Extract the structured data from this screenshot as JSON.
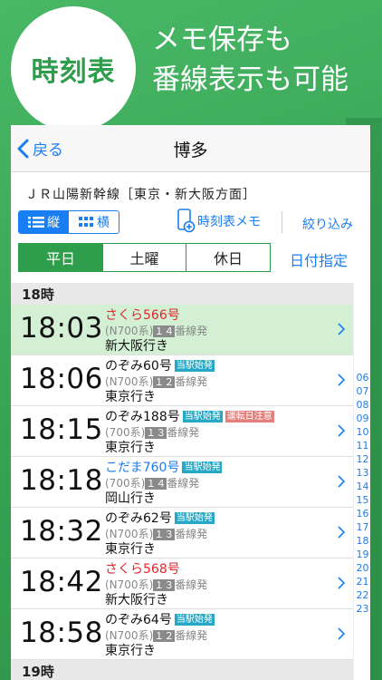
{
  "promo": {
    "circle_text": "時刻表",
    "line1": "メモ保存も",
    "line2": "番線表示も可能"
  },
  "nav": {
    "back_label": "戻る",
    "title": "博多"
  },
  "line_name": "ＪＲ山陽新幹線［東京・新大阪方面］",
  "toolbar": {
    "vertical_label": "縦",
    "horizontal_label": "横",
    "memo_label": "時刻表メモ",
    "filter_label": "絞り込み"
  },
  "day_tabs": {
    "weekday": "平日",
    "saturday": "土曜",
    "holiday": "休日",
    "date_pick": "日付指定"
  },
  "hour18": "18時",
  "hour19": "19時",
  "rows": [
    {
      "time": "18:03",
      "name": "さくら566号",
      "badge1": "",
      "badge2": "",
      "series": "(N700系)",
      "track": "１４",
      "track_suffix": "番線発",
      "dest": "新大阪行き"
    },
    {
      "time": "18:06",
      "name": "のぞみ60号",
      "badge1": "当駅始発",
      "badge2": "",
      "series": "(N700系)",
      "track": "１２",
      "track_suffix": "番線発",
      "dest": "東京行き"
    },
    {
      "time": "18:15",
      "name": "のぞみ188号",
      "badge1": "当駅始発",
      "badge2": "運転日注意",
      "series": "(700系)",
      "track": "１３",
      "track_suffix": "番線発",
      "dest": "東京行き"
    },
    {
      "time": "18:18",
      "name": "こだま760号",
      "badge1": "当駅始発",
      "badge2": "",
      "series": "(700系)",
      "track": "１４",
      "track_suffix": "番線発",
      "dest": "岡山行き"
    },
    {
      "time": "18:32",
      "name": "のぞみ62号",
      "badge1": "当駅始発",
      "badge2": "",
      "series": "(N700系)",
      "track": "１３",
      "track_suffix": "番線発",
      "dest": "東京行き"
    },
    {
      "time": "18:42",
      "name": "さくら568号",
      "badge1": "",
      "badge2": "",
      "series": "(N700系)",
      "track": "１３",
      "track_suffix": "番線発",
      "dest": "新大阪行き"
    },
    {
      "time": "18:58",
      "name": "のぞみ64号",
      "badge1": "当駅始発",
      "badge2": "",
      "series": "(N700系)",
      "track": "１２",
      "track_suffix": "番線発",
      "dest": "東京行き"
    }
  ],
  "hour_index": [
    "06",
    "07",
    "08",
    "09",
    "10",
    "11",
    "12",
    "13",
    "14",
    "15",
    "16",
    "17",
    "18",
    "19",
    "20",
    "21",
    "22",
    "23"
  ],
  "colors": {
    "accent": "#1a7ef3",
    "brand_green": "#2f9e4c",
    "highlight_row": "#d4f0d4",
    "red_train": "#e0262b",
    "badge_teal": "#27a8c4",
    "badge_pink": "#e2807e"
  },
  "icons": {
    "back": "chevron-left-icon",
    "vertical": "list-icon",
    "horizontal": "grid-icon",
    "memo": "phone-add-icon",
    "row": "chevron-right-icon"
  }
}
